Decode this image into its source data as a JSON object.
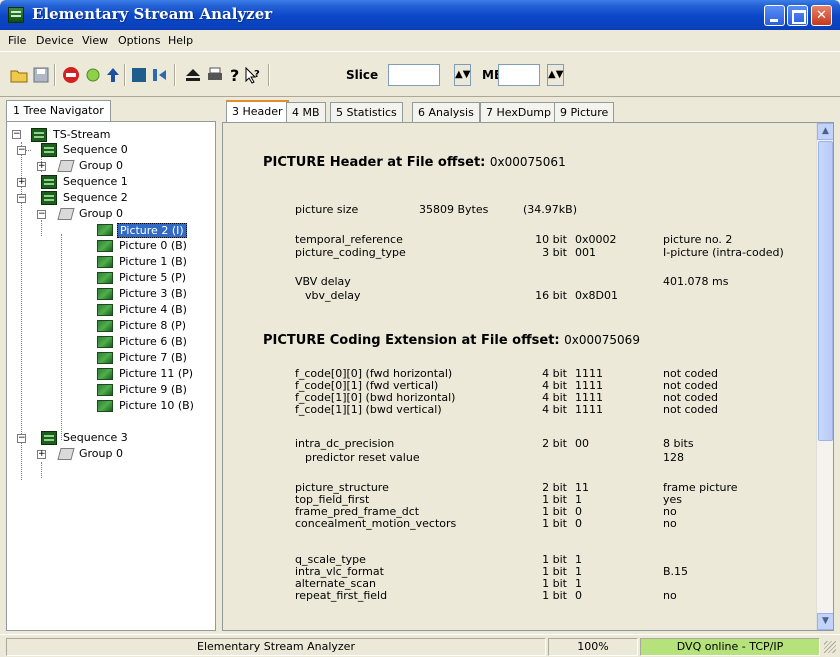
{
  "window": {
    "title": "Elementary Stream Analyzer"
  },
  "menu": [
    "File",
    "Device",
    "View",
    "Options",
    "Help"
  ],
  "toolbar": {
    "slice_label": "Slice",
    "slice_value": "",
    "mb_label": "MB",
    "mb_value": ""
  },
  "left_panel": {
    "tab_label": "1 Tree Navigator",
    "tree": {
      "root": "TS-Stream",
      "seq0": "Sequence 0",
      "seq0_group0": "Group 0",
      "seq1": "Sequence 1",
      "seq2": "Sequence 2",
      "seq2_group0": "Group 0",
      "pictures": [
        "Picture 2 (I)",
        "Picture 0 (B)",
        "Picture 1 (B)",
        "Picture 5 (P)",
        "Picture 3 (B)",
        "Picture 4 (B)",
        "Picture 8 (P)",
        "Picture 6 (B)",
        "Picture 7 (B)",
        "Picture 11 (P)",
        "Picture 9 (B)",
        "Picture 10 (B)"
      ],
      "seq3": "Sequence 3",
      "seq3_group0": "Group 0"
    }
  },
  "right_tabs": [
    "3 Header",
    "4 MB",
    "5 Statistics",
    "6 Analysis",
    "7 HexDump",
    "9 Picture"
  ],
  "header": {
    "section1_title": "PICTURE Header at File offset:",
    "section1_offset": "0x00075061",
    "picture_size_label": "picture size",
    "picture_size_bytes": "35809 Bytes",
    "picture_size_kb": "(34.97kB)",
    "rows1": [
      {
        "name": "temporal_reference",
        "bits": "10 bit",
        "value": "0x0002",
        "desc": "picture no. 2"
      },
      {
        "name": "picture_coding_type",
        "bits": "3 bit",
        "value": "001",
        "desc": "I-picture (intra-coded)"
      }
    ],
    "vbv_label": "VBV delay",
    "vbv_desc": "401.078 ms",
    "vbv_row": {
      "name": "vbv_delay",
      "bits": "16 bit",
      "value": "0x8D01"
    },
    "section2_title": "PICTURE Coding Extension at File offset:",
    "section2_offset": "0x00075069",
    "rows_fcode": [
      {
        "name": "f_code[0][0]  (fwd horizontal)",
        "bits": "4 bit",
        "value": "1111",
        "desc": "not coded"
      },
      {
        "name": "f_code[0][1]  (fwd vertical)",
        "bits": "4 bit",
        "value": "1111",
        "desc": "not coded"
      },
      {
        "name": "f_code[1][0]  (bwd horizontal)",
        "bits": "4 bit",
        "value": "1111",
        "desc": "not coded"
      },
      {
        "name": "f_code[1][1]  (bwd vertical)",
        "bits": "4 bit",
        "value": "1111",
        "desc": "not coded"
      }
    ],
    "intra_dc": {
      "name": "intra_dc_precision",
      "bits": "2 bit",
      "value": "00",
      "desc": "8 bits"
    },
    "predictor_label": "predictor reset value",
    "predictor_value": "128",
    "rows_struct": [
      {
        "name": "picture_structure",
        "bits": "2 bit",
        "value": "11",
        "desc": "frame picture"
      },
      {
        "name": "top_field_first",
        "bits": "1 bit",
        "value": "1",
        "desc": "yes"
      },
      {
        "name": "frame_pred_frame_dct",
        "bits": "1 bit",
        "value": "0",
        "desc": "no"
      },
      {
        "name": "concealment_motion_vectors",
        "bits": "1 bit",
        "value": "0",
        "desc": "no"
      }
    ],
    "rows_scale": [
      {
        "name": "q_scale_type",
        "bits": "1 bit",
        "value": "1",
        "desc": ""
      },
      {
        "name": "intra_vlc_format",
        "bits": "1 bit",
        "value": "1",
        "desc": "B.15"
      },
      {
        "name": "alternate_scan",
        "bits": "1 bit",
        "value": "1",
        "desc": ""
      },
      {
        "name": "repeat_first_field",
        "bits": "1 bit",
        "value": "0",
        "desc": "no"
      }
    ]
  },
  "status": {
    "app": "Elementary Stream Analyzer",
    "zoom": "100%",
    "connection": "DVQ online - TCP/IP",
    "connection_color": "#b5e27a"
  }
}
